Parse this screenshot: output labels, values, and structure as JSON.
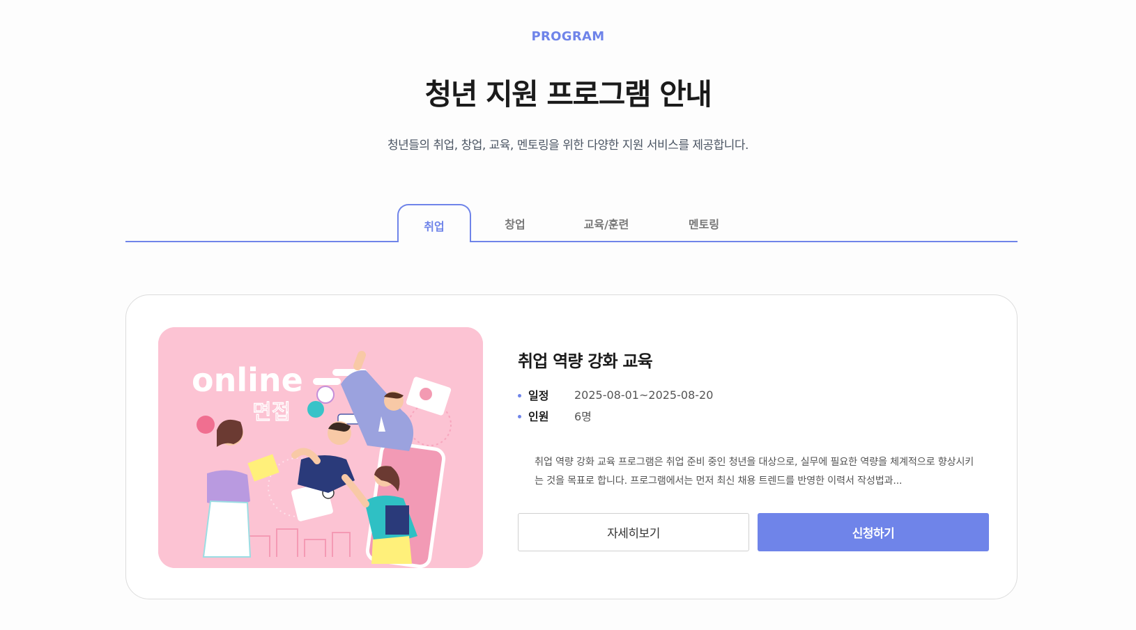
{
  "header": {
    "eyebrow": "PROGRAM",
    "title": "청년 지원 프로그램 안내",
    "subtitle": "청년들의 취업, 창업, 교육, 멘토링을 위한 다양한 지원 서비스를 제공합니다."
  },
  "tabs": [
    {
      "label": "취업",
      "active": true
    },
    {
      "label": "창업",
      "active": false
    },
    {
      "label": "교육/훈련",
      "active": false
    },
    {
      "label": "멘토링",
      "active": false
    }
  ],
  "program": {
    "title": "취업 역량 강화 교육",
    "image_text": {
      "line1": "online",
      "line2": "면접"
    },
    "meta": [
      {
        "label": "일정",
        "value": "2025-08-01~2025-08-20"
      },
      {
        "label": "인원",
        "value": "6명"
      }
    ],
    "description": "취업 역량 강화 교육 프로그램은 취업 준비 중인 청년을 대상으로, 실무에 필요한 역량을 체계적으로 향상시키는 것을 목표로 합니다. 프로그램에서는 먼저 최신 채용 트렌드를 반영한 이력서 작성법과...",
    "buttons": {
      "detail": "자세히보기",
      "apply": "신청하기"
    }
  },
  "colors": {
    "accent": "#6f84e9",
    "image_bg": "#fcc3d3"
  }
}
